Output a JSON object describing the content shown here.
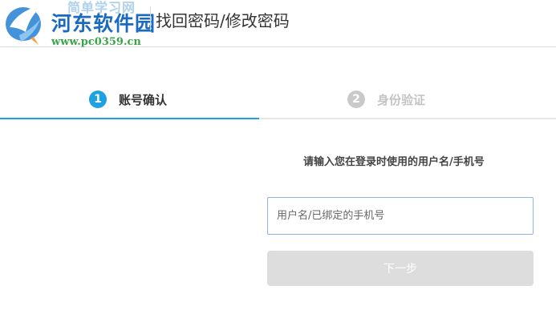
{
  "header": {
    "logo": {
      "icon": "bird-logo-icon",
      "watermark_top": "简单学习网",
      "watermark_main": "河东软件园",
      "watermark_url": "www.pc0359.cn"
    },
    "title": "找回密码/修改密码"
  },
  "steps": [
    {
      "number": "1",
      "label": "账号确认",
      "state": "active",
      "color": "#1fa0e0"
    },
    {
      "number": "2",
      "label": "身份验证",
      "state": "inactive",
      "color": "#c9c9c9"
    }
  ],
  "form": {
    "hint": "请输入您在登录时使用的用户名/手机号",
    "username": {
      "value": "",
      "placeholder": "用户名/已绑定的手机号"
    },
    "next_label": "下一步"
  }
}
